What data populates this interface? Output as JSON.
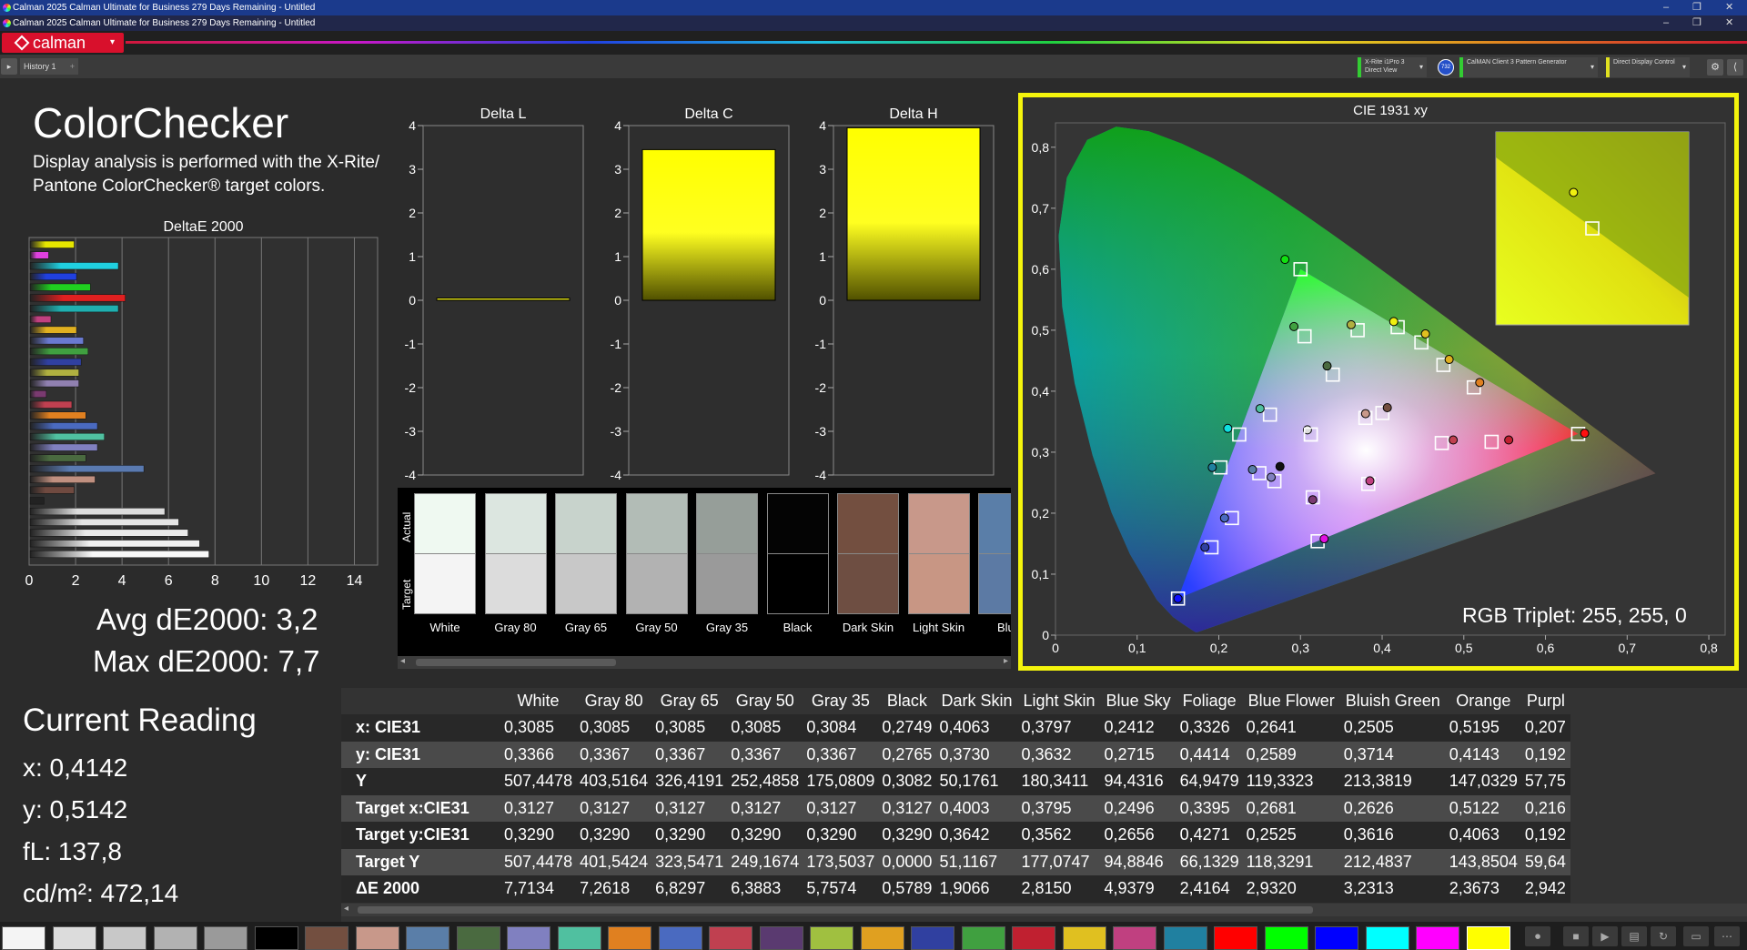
{
  "window": {
    "title_primary": "Calman 2025 Calman Ultimate for Business 279 Days Remaining  - Untitled",
    "title_secondary": "Calman 2025 Calman Ultimate for Business 279 Days Remaining  - Untitled",
    "minimize": "–",
    "restore": "❐",
    "close": "✕"
  },
  "brand": {
    "name": "calman",
    "caret": "▾"
  },
  "tabs": {
    "history_label": "History 1",
    "history_btn": "▸",
    "add": "+"
  },
  "devices": [
    {
      "line1": "X-Rite i1Pro 3",
      "line2": "Direct View",
      "accent": "#33cc33"
    },
    {
      "line1": "CalMAN Client 3 Pattern Generator",
      "line2": "",
      "accent": "#33cc33"
    },
    {
      "line1": "Direct Display Control",
      "line2": "",
      "accent": "#e0e020"
    }
  ],
  "device_badge": "732",
  "sys_buttons": [
    "⚙",
    "⟨"
  ],
  "page": {
    "title": "ColorChecker",
    "description": "Display analysis is performed with the X-Rite/ Pantone ColorChecker® target colors."
  },
  "deltae_chart": {
    "title": "DeltaE 2000",
    "xticks": [
      "0",
      "2",
      "4",
      "6",
      "8",
      "10",
      "12",
      "14"
    ],
    "xlim": [
      0,
      15
    ],
    "bars": [
      {
        "v": 1.9,
        "c": "#e6e600"
      },
      {
        "v": 0.8,
        "c": "#e040e0"
      },
      {
        "v": 3.8,
        "c": "#20d0e0"
      },
      {
        "v": 2.0,
        "c": "#2040e0"
      },
      {
        "v": 2.6,
        "c": "#20d020"
      },
      {
        "v": 4.1,
        "c": "#e02020"
      },
      {
        "v": 3.8,
        "c": "#20b0b0"
      },
      {
        "v": 0.9,
        "c": "#c04080"
      },
      {
        "v": 2.0,
        "c": "#e0b020"
      },
      {
        "v": 2.3,
        "c": "#6a7ad0"
      },
      {
        "v": 2.5,
        "c": "#40a040"
      },
      {
        "v": 2.2,
        "c": "#3040a0"
      },
      {
        "v": 2.1,
        "c": "#b0b040"
      },
      {
        "v": 2.1,
        "c": "#9080b0"
      },
      {
        "v": 0.7,
        "c": "#7a3a70"
      },
      {
        "v": 1.8,
        "c": "#c04050"
      },
      {
        "v": 2.4,
        "c": "#e08020"
      },
      {
        "v": 2.9,
        "c": "#4a6ac0"
      },
      {
        "v": 3.2,
        "c": "#50c0a0"
      },
      {
        "v": 2.9,
        "c": "#8080c0"
      },
      {
        "v": 2.4,
        "c": "#4a6a40"
      },
      {
        "v": 4.9,
        "c": "#5a7ab0"
      },
      {
        "v": 2.8,
        "c": "#c09080"
      },
      {
        "v": 1.9,
        "c": "#704a40"
      },
      {
        "v": 0.6,
        "c": "#222222"
      },
      {
        "v": 5.8,
        "c": "#dddddd"
      },
      {
        "v": 6.4,
        "c": "#e4e4e4"
      },
      {
        "v": 6.8,
        "c": "#eaeaea"
      },
      {
        "v": 7.3,
        "c": "#f0f0f0"
      },
      {
        "v": 7.7,
        "c": "#f8f8f8"
      }
    ]
  },
  "summary": {
    "avg": "Avg dE2000: 3,2",
    "max": "Max dE2000: 7,7"
  },
  "current_reading": {
    "title": "Current Reading",
    "x": "x: 0,4142",
    "y": "y: 0,5142",
    "fl": "fL: 137,8",
    "cdm2": "cd/m²: 472,14"
  },
  "delta_charts": [
    {
      "title": "Delta L",
      "value": 0.05
    },
    {
      "title": "Delta C",
      "value": 3.45
    },
    {
      "title": "Delta H",
      "value": 3.95
    }
  ],
  "delta_ticks": [
    "4",
    "3",
    "2",
    "1",
    "0",
    "-1",
    "-2",
    "-3",
    "-4"
  ],
  "chips": {
    "actual_label": "Actual",
    "target_label": "Target",
    "items": [
      {
        "name": "White",
        "actual": "#eff9f1",
        "target": "#f4f4f4"
      },
      {
        "name": "Gray 80",
        "actual": "#dce6e0",
        "target": "#dcdcdc"
      },
      {
        "name": "Gray 65",
        "actual": "#c8d3cc",
        "target": "#c8c8c8"
      },
      {
        "name": "Gray 50",
        "actual": "#b2bcb6",
        "target": "#b2b2b2"
      },
      {
        "name": "Gray 35",
        "actual": "#969e99",
        "target": "#9a9a9a"
      },
      {
        "name": "Black",
        "actual": "#040404",
        "target": "#000000"
      },
      {
        "name": "Dark Skin",
        "actual": "#734f40",
        "target": "#6e4e42"
      },
      {
        "name": "Light Skin",
        "actual": "#c8988a",
        "target": "#c89684"
      },
      {
        "name": "Blue",
        "actual": "#5a7ea8",
        "target": "#5c7aa4"
      }
    ]
  },
  "cie_chart": {
    "title": "CIE 1931 xy",
    "xticks": [
      "0",
      "0,1",
      "0,2",
      "0,3",
      "0,4",
      "0,5",
      "0,6",
      "0,7",
      "0,8"
    ],
    "yticks": [
      "0",
      "0,1",
      "0,2",
      "0,3",
      "0,4",
      "0,5",
      "0,6",
      "0,7",
      "0,8"
    ],
    "xlim": [
      0,
      0.82
    ],
    "ylim": [
      0,
      0.84
    ],
    "gamut": [
      [
        0.64,
        0.33
      ],
      [
        0.3,
        0.6
      ],
      [
        0.15,
        0.06
      ]
    ],
    "points": [
      {
        "tx": 0.3127,
        "ty": 0.329,
        "ax": 0.3085,
        "ay": 0.3366,
        "c": "#dddddd"
      },
      {
        "tx": 0.3127,
        "ty": 0.329,
        "ax": 0.2749,
        "ay": 0.2765,
        "c": "#111111"
      },
      {
        "tx": 0.4003,
        "ty": 0.3642,
        "ax": 0.4063,
        "ay": 0.373,
        "c": "#734f40"
      },
      {
        "tx": 0.3795,
        "ty": 0.3562,
        "ax": 0.3797,
        "ay": 0.3632,
        "c": "#c8988a"
      },
      {
        "tx": 0.2496,
        "ty": 0.2656,
        "ax": 0.2412,
        "ay": 0.2715,
        "c": "#5a7ea8"
      },
      {
        "tx": 0.3395,
        "ty": 0.4271,
        "ax": 0.3326,
        "ay": 0.4414,
        "c": "#4a6a40"
      },
      {
        "tx": 0.2681,
        "ty": 0.2525,
        "ax": 0.2641,
        "ay": 0.2589,
        "c": "#8080c0"
      },
      {
        "tx": 0.2626,
        "ty": 0.3616,
        "ax": 0.2505,
        "ay": 0.3714,
        "c": "#50c0a0"
      },
      {
        "tx": 0.5122,
        "ty": 0.4063,
        "ax": 0.5195,
        "ay": 0.4143,
        "c": "#e08020"
      },
      {
        "tx": 0.216,
        "ty": 0.192,
        "ax": 0.207,
        "ay": 0.192,
        "c": "#4a6ac0"
      },
      {
        "tx": 0.473,
        "ty": 0.315,
        "ax": 0.487,
        "ay": 0.32,
        "c": "#c04050"
      },
      {
        "tx": 0.315,
        "ty": 0.226,
        "ax": 0.315,
        "ay": 0.222,
        "c": "#7a3a70"
      },
      {
        "tx": 0.37,
        "ty": 0.5,
        "ax": 0.362,
        "ay": 0.509,
        "c": "#b0b040"
      },
      {
        "tx": 0.475,
        "ty": 0.443,
        "ax": 0.482,
        "ay": 0.452,
        "c": "#e0b020"
      },
      {
        "tx": 0.191,
        "ty": 0.144,
        "ax": 0.183,
        "ay": 0.144,
        "c": "#3040a0"
      },
      {
        "tx": 0.305,
        "ty": 0.49,
        "ax": 0.292,
        "ay": 0.506,
        "c": "#40a040"
      },
      {
        "tx": 0.534,
        "ty": 0.317,
        "ax": 0.555,
        "ay": 0.32,
        "c": "#c02030"
      },
      {
        "tx": 0.448,
        "ty": 0.48,
        "ax": 0.453,
        "ay": 0.494,
        "c": "#e0c020"
      },
      {
        "tx": 0.383,
        "ty": 0.248,
        "ax": 0.385,
        "ay": 0.253,
        "c": "#c04080"
      },
      {
        "tx": 0.202,
        "ty": 0.275,
        "ax": 0.192,
        "ay": 0.275,
        "c": "#2080a0"
      },
      {
        "tx": 0.64,
        "ty": 0.33,
        "ax": 0.648,
        "ay": 0.331,
        "c": "#ff1010"
      },
      {
        "tx": 0.3,
        "ty": 0.6,
        "ax": 0.281,
        "ay": 0.616,
        "c": "#10e010"
      },
      {
        "tx": 0.15,
        "ty": 0.06,
        "ax": 0.15,
        "ay": 0.06,
        "c": "#1010ff"
      },
      {
        "tx": 0.225,
        "ty": 0.329,
        "ax": 0.211,
        "ay": 0.339,
        "c": "#10e0e0"
      },
      {
        "tx": 0.321,
        "ty": 0.154,
        "ax": 0.329,
        "ay": 0.158,
        "c": "#e010e0"
      },
      {
        "tx": 0.419,
        "ty": 0.505,
        "ax": 0.4142,
        "ay": 0.5142,
        "c": "#f0f010"
      }
    ],
    "inset": {
      "tx": 0.419,
      "ty": 0.505,
      "ax": 0.4142,
      "ay": 0.5142
    },
    "rgb_triplet": "RGB Triplet: 255, 255, 0"
  },
  "table": {
    "columns": [
      "White",
      "Gray 80",
      "Gray 65",
      "Gray 50",
      "Gray 35",
      "Black",
      "Dark Skin",
      "Light Skin",
      "Blue Sky",
      "Foliage",
      "Blue Flower",
      "Bluish Green",
      "Orange",
      "Purpl"
    ],
    "rows": [
      {
        "label": "x: CIE31",
        "values": [
          "0,3085",
          "0,3085",
          "0,3085",
          "0,3085",
          "0,3084",
          "0,2749",
          "0,4063",
          "0,3797",
          "0,2412",
          "0,3326",
          "0,2641",
          "0,2505",
          "0,5195",
          "0,207"
        ]
      },
      {
        "label": "y: CIE31",
        "values": [
          "0,3366",
          "0,3367",
          "0,3367",
          "0,3367",
          "0,3367",
          "0,2765",
          "0,3730",
          "0,3632",
          "0,2715",
          "0,4414",
          "0,2589",
          "0,3714",
          "0,4143",
          "0,192"
        ]
      },
      {
        "label": "Y",
        "values": [
          "507,4478",
          "403,5164",
          "326,4191",
          "252,4858",
          "175,0809",
          "0,3082",
          "50,1761",
          "180,3411",
          "94,4316",
          "64,9479",
          "119,3323",
          "213,3819",
          "147,0329",
          "57,75"
        ]
      },
      {
        "label": "Target x:CIE31",
        "values": [
          "0,3127",
          "0,3127",
          "0,3127",
          "0,3127",
          "0,3127",
          "0,3127",
          "0,4003",
          "0,3795",
          "0,2496",
          "0,3395",
          "0,2681",
          "0,2626",
          "0,5122",
          "0,216"
        ]
      },
      {
        "label": "Target y:CIE31",
        "values": [
          "0,3290",
          "0,3290",
          "0,3290",
          "0,3290",
          "0,3290",
          "0,3290",
          "0,3642",
          "0,3562",
          "0,2656",
          "0,4271",
          "0,2525",
          "0,3616",
          "0,4063",
          "0,192"
        ]
      },
      {
        "label": "Target Y",
        "values": [
          "507,4478",
          "401,5424",
          "323,5471",
          "249,1674",
          "173,5037",
          "0,0000",
          "51,1167",
          "177,0747",
          "94,8846",
          "66,1329",
          "118,3291",
          "212,4837",
          "143,8504",
          "59,64"
        ]
      },
      {
        "label": "ΔE 2000",
        "values": [
          "7,7134",
          "7,2618",
          "6,8297",
          "6,3883",
          "5,7574",
          "0,5789",
          "1,9066",
          "2,8150",
          "4,9379",
          "2,4164",
          "2,9320",
          "3,2313",
          "2,3673",
          "2,942"
        ]
      }
    ]
  },
  "swatches": [
    "#f4f4f4",
    "#dcdcdc",
    "#c8c8c8",
    "#b2b2b2",
    "#9a9a9a",
    "#000000",
    "#734f40",
    "#c8988a",
    "#5a7ea8",
    "#4a6a40",
    "#8080c0",
    "#50c0a0",
    "#e08020",
    "#4a6ac0",
    "#c04050",
    "#5a3a70",
    "#a0c040",
    "#e0a020",
    "#3040a0",
    "#40a040",
    "#c02030",
    "#e0c020",
    "#c04080",
    "#2080a0",
    "#ff0000",
    "#00ff00",
    "#0000ff",
    "#00ffff",
    "#ff00ff",
    "#ffff00"
  ],
  "colors": {
    "accent_yellow": "#f4f40c",
    "brand_red": "#d8102c"
  }
}
